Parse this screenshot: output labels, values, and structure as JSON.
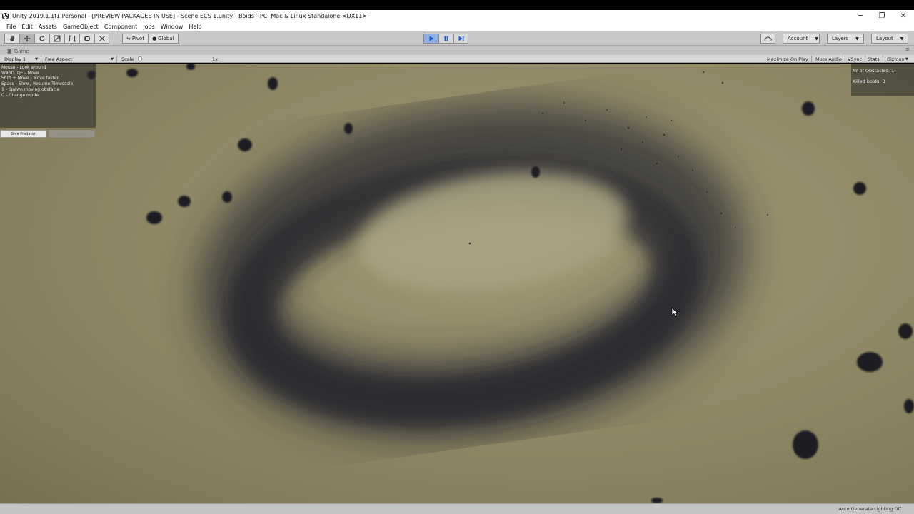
{
  "window": {
    "title": "Unity 2019.1.1f1 Personal - [PREVIEW PACKAGES IN USE] - Scene ECS 1.unity - Boids - PC, Mac & Linux Standalone <DX11>",
    "minimize": "─",
    "maximize": "❐",
    "close": "✕"
  },
  "menu": {
    "items": [
      "File",
      "Edit",
      "Assets",
      "GameObject",
      "Component",
      "Jobs",
      "Window",
      "Help"
    ]
  },
  "toolbar": {
    "pivot_label": "Pivot",
    "global_label": "Global",
    "account_label": "Account",
    "layers_label": "Layers",
    "layout_label": "Layout"
  },
  "game_tab": {
    "label": "Game",
    "display": "Display 1",
    "aspect": "Free Aspect",
    "scale_label": "Scale",
    "scale_value": "1x",
    "maximize_on_play": "Maximize On Play",
    "mute_audio": "Mute Audio",
    "vsync": "VSync",
    "stats": "Stats",
    "gizmos": "Gizmos"
  },
  "hud": {
    "help_lines": [
      "Mouse - Look around",
      "WASD, QE - Move",
      "Shift + Move - Move faster",
      "Space - Slow / Resume Timescale",
      "1 - Spawn moving obstacle",
      "C - Change mode"
    ],
    "button_primary": "Give Predator",
    "button_secondary": "Remove Predator",
    "obstacles": "Nr of Obstacles: 1",
    "killed": "Killed boids: 3"
  },
  "status": {
    "lighting": "Auto Generate Lighting Off"
  },
  "colors": {
    "ground": "#958d6b",
    "boids": "#2a2a33",
    "play_active": "#8fb1e6"
  }
}
